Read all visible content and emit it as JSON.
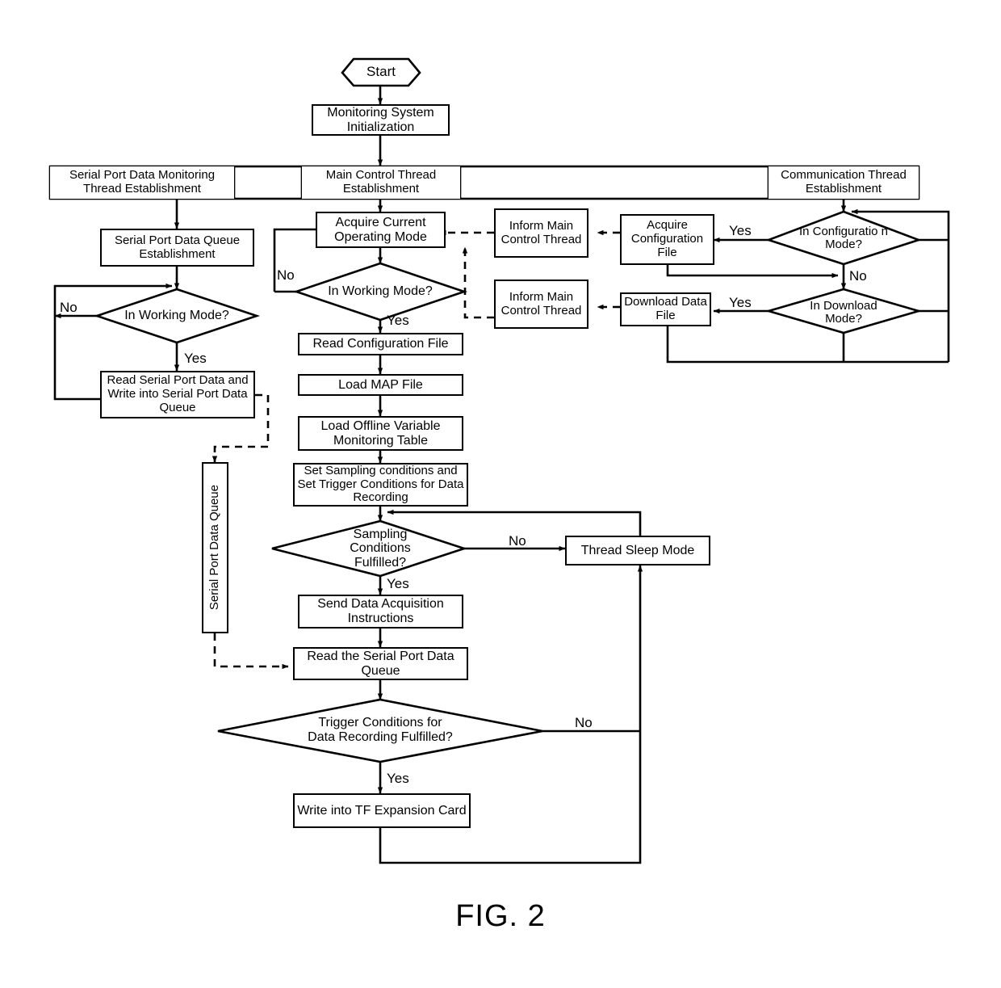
{
  "figure": {
    "caption": "FIG. 2"
  },
  "nodes": {
    "start": "Start",
    "init": "Monitoring System Initialization",
    "band_left": "Serial Port Data Monitoring Thread Establishment",
    "band_mid": "Main Control Thread Establishment",
    "band_right": "Communication Thread Establishment",
    "spd_queue_est": "Serial Port Data Queue Establishment",
    "left_working_mode": "In Working Mode?",
    "read_serial": "Read Serial Port Data and Write into Serial Port Data Queue",
    "serial_queue_vertical": "Serial Port Data Queue",
    "acquire_mode": "Acquire  Current Operating Mode",
    "main_working_mode": "In Working Mode?",
    "read_config": "Read Configuration File",
    "load_map": "Load MAP File",
    "load_offline": "Load Offline Variable Monitoring Table",
    "set_sampling": "Set Sampling conditions and Set Trigger Conditions for Data Recording",
    "sampling_fulfilled": "Sampling Conditions Fulfilled?",
    "send_data": "Send Data Acquisition Instructions",
    "read_queue": "Read the Serial Port Data Queue",
    "trigger_fulfilled": "Trigger Conditions for Data Recording Fulfilled?",
    "write_tf": "Write into TF Expansion Card",
    "thread_sleep": "Thread Sleep Mode",
    "inform_main_1": "Inform Main Control Thread",
    "inform_main_2": "Inform Main Control Thread",
    "acquire_config": "Acquire Configuration File",
    "download_data": "Download Data File",
    "in_config_mode": "In Configuratio n Mode?",
    "in_download_mode": "In Download Mode?"
  },
  "edge_labels": {
    "left_no": "No",
    "left_yes": "Yes",
    "main_no": "No",
    "main_yes": "Yes",
    "sampling_no": "No",
    "sampling_yes": "Yes",
    "trigger_no": "No",
    "trigger_yes": "Yes",
    "config_yes": "Yes",
    "config_no": "No",
    "download_yes": "Yes"
  },
  "colors": {
    "stroke": "#000000",
    "background": "#ffffff"
  }
}
